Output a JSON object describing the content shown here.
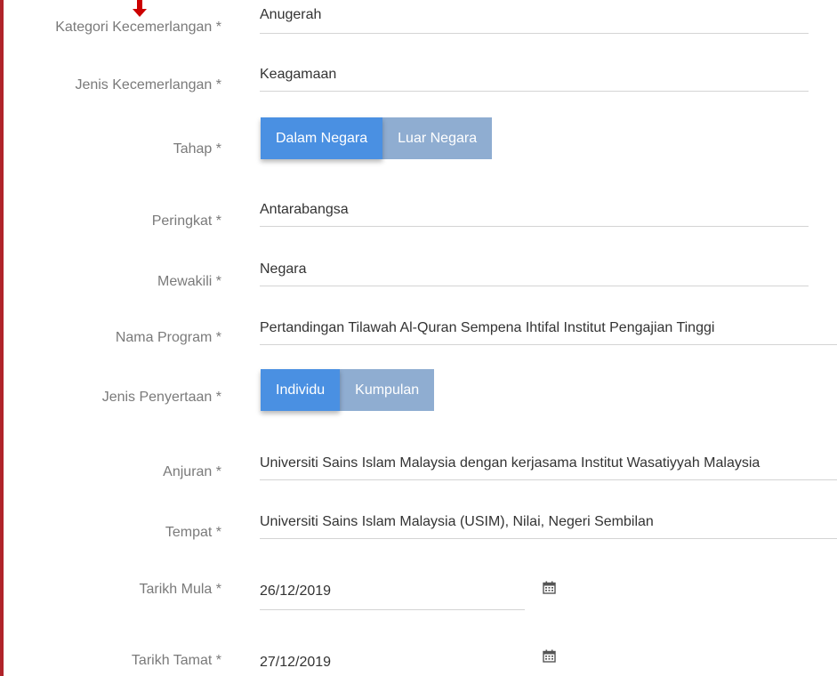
{
  "form": {
    "kategori": {
      "label": "Kategori Kecemerlangan *",
      "value": "Anugerah"
    },
    "jenis": {
      "label": "Jenis Kecemerlangan *",
      "value": "Keagamaan"
    },
    "tahap": {
      "label": "Tahap *",
      "options": [
        "Dalam Negara",
        "Luar Negara"
      ],
      "selected": "Dalam Negara"
    },
    "peringkat": {
      "label": "Peringkat *",
      "value": "Antarabangsa"
    },
    "mewakili": {
      "label": "Mewakili *",
      "value": "Negara"
    },
    "nama_program": {
      "label": "Nama Program *",
      "value": "Pertandingan Tilawah Al-Quran Sempena Ihtifal Institut Pengajian Tinggi"
    },
    "jenis_penyertaan": {
      "label": "Jenis Penyertaan *",
      "options": [
        "Individu",
        "Kumpulan"
      ],
      "selected": "Individu"
    },
    "anjuran": {
      "label": "Anjuran *",
      "value": "Universiti Sains Islam Malaysia dengan kerjasama Institut Wasatiyyah Malaysia"
    },
    "tempat": {
      "label": "Tempat *",
      "value": "Universiti Sains Islam Malaysia (USIM), Nilai, Negeri Sembilan"
    },
    "tarikh_mula": {
      "label": "Tarikh Mula *",
      "value": "26/12/2019"
    },
    "tarikh_tamat": {
      "label": "Tarikh Tamat *",
      "value": "27/12/2019"
    }
  },
  "icons": {
    "calendar": "calendar-icon",
    "arrow": "arrow-down-icon"
  },
  "colors": {
    "active": "#4a90e2",
    "inactive": "#8fadd1",
    "border": "#b0232a",
    "arrow": "#cc0000"
  }
}
